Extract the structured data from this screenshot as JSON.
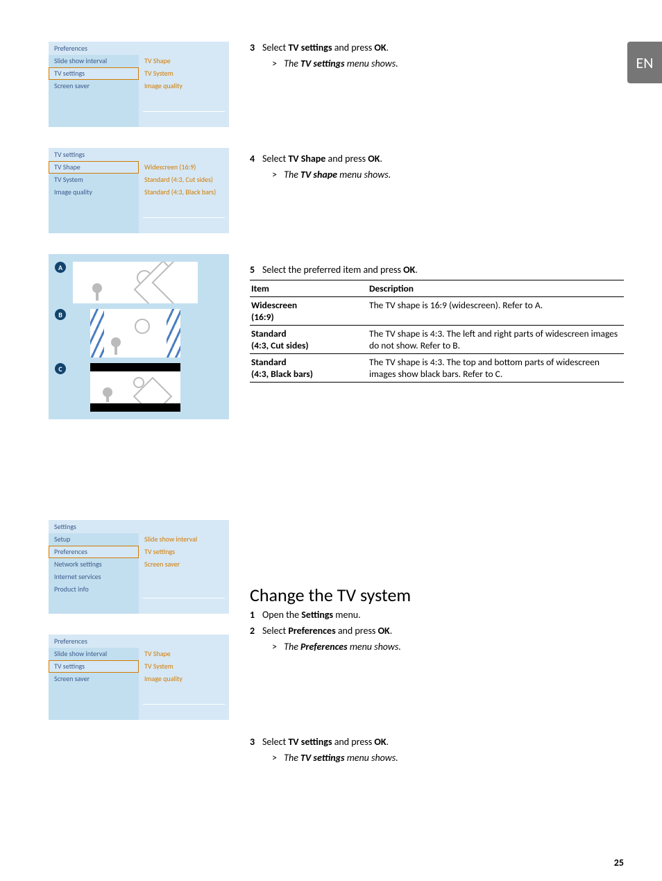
{
  "lang_tab": "EN",
  "page_number": "25",
  "menus": {
    "preferences": {
      "header": "Preferences",
      "left": [
        "Slide show interval",
        "TV settings",
        "Screen saver"
      ],
      "selected_index": 1,
      "right": [
        "TV Shape",
        "TV System",
        "Image quality"
      ]
    },
    "tvsettings": {
      "header": "TV settings",
      "left": [
        "TV Shape",
        "TV System",
        "Image quality"
      ],
      "selected_index": 0,
      "right": [
        "Widescreen (16:9)",
        "Standard (4:3, Cut sides)",
        "Standard (4:3, Black bars)"
      ]
    },
    "settings": {
      "header": "Settings",
      "left": [
        "Setup",
        "Preferences",
        "Network settings",
        "Internet services",
        "Product info"
      ],
      "selected_index": 1,
      "right": [
        "Slide show interval",
        "TV settings",
        "Screen saver"
      ]
    }
  },
  "shape_labels": {
    "A": "A",
    "B": "B",
    "C": "C"
  },
  "steps": {
    "s3": {
      "num": "3",
      "prefix": "Select ",
      "bold1": "TV settings",
      "mid": " and press ",
      "bold2": "OK",
      "suffix": "."
    },
    "s3r": {
      "arrow": ">",
      "prefix": "The ",
      "bold": "TV settings",
      "suffix": " menu shows."
    },
    "s4": {
      "num": "4",
      "prefix": "Select ",
      "bold1": "TV Shape",
      "mid": " and press ",
      "bold2": "OK",
      "suffix": "."
    },
    "s4r": {
      "arrow": ">",
      "prefix": "The ",
      "bold": "TV shape",
      "suffix": " menu shows."
    },
    "s5": {
      "num": "5",
      "prefix": "Select the preferred item and press ",
      "bold": "OK",
      "suffix": "."
    },
    "c1": {
      "num": "1",
      "prefix": "Open the ",
      "bold": "Settings",
      "suffix": " menu."
    },
    "c2": {
      "num": "2",
      "prefix": "Select ",
      "bold1": "Preferences",
      "mid": " and press ",
      "bold2": "OK",
      "suffix": "."
    },
    "c2r": {
      "arrow": ">",
      "prefix": "The ",
      "bold": "Preferences",
      "suffix": " menu shows."
    },
    "c3": {
      "num": "3",
      "prefix": "Select ",
      "bold1": "TV settings",
      "mid": " and press ",
      "bold2": "OK",
      "suffix": "."
    },
    "c3r": {
      "arrow": ">",
      "prefix": "The ",
      "bold": "TV settings",
      "suffix": " menu shows."
    }
  },
  "section_title": "Change the TV system",
  "table": {
    "head_item": "Item",
    "head_desc": "Description",
    "rows": [
      {
        "item1": "Widescreen",
        "item2": "(16:9)",
        "desc": "The TV shape is 16:9 (widescreen). Refer to A."
      },
      {
        "item1": "Standard",
        "item2": "(4:3, Cut sides)",
        "desc": "The TV shape is 4:3. The left and right parts of widescreen images do not show. Refer to B."
      },
      {
        "item1": "Standard",
        "item2": "(4:3, Black bars)",
        "desc": "The TV shape is 4:3. The top and bottom parts of widescreen images show black bars. Refer to C."
      }
    ]
  }
}
